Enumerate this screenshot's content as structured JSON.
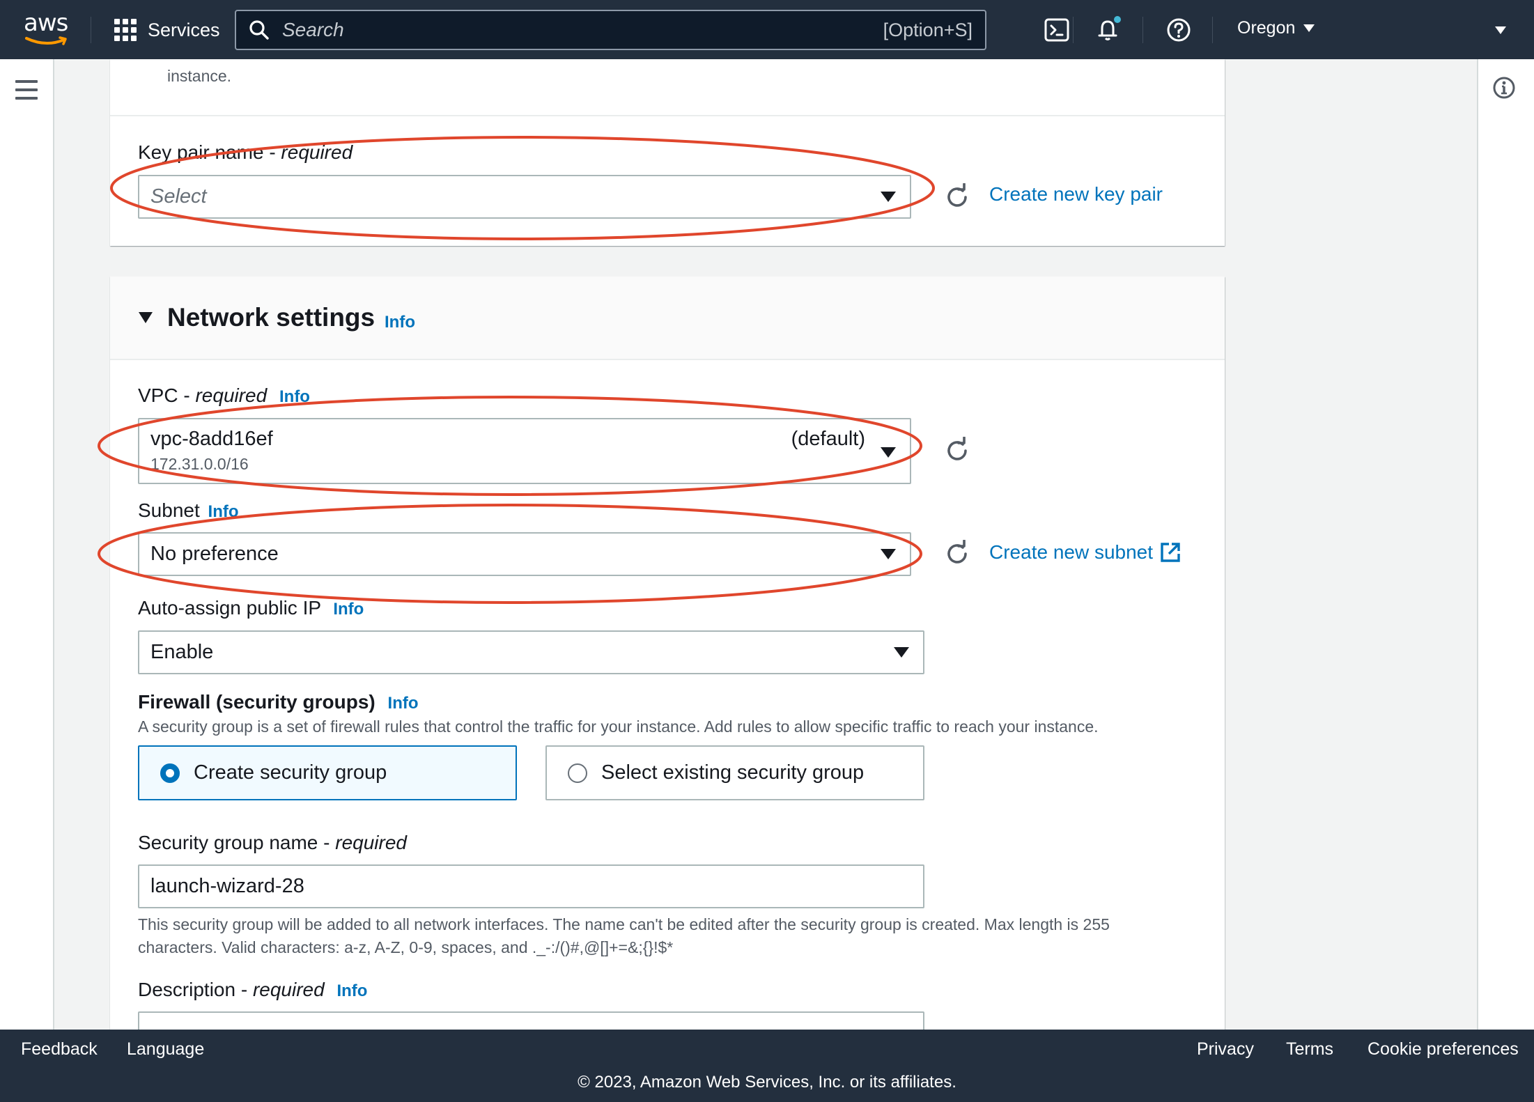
{
  "topnav": {
    "logo_text": "aws",
    "services_label": "Services",
    "search_placeholder": "Search",
    "search_shortcut": "[Option+S]",
    "region_label": "Oregon",
    "notification_dot_color": "#44b9d6"
  },
  "key_pair_panel": {
    "top_desc_fragment": "instance.",
    "key_pair_label": "Key pair name - ",
    "key_pair_required": "required",
    "key_pair_placeholder": "Select",
    "create_key_pair_link": "Create new key pair"
  },
  "network_settings": {
    "title": "Network settings",
    "title_info": "Info",
    "vpc_label": "VPC - ",
    "vpc_required": "required",
    "vpc_info": "Info",
    "vpc_value": "vpc-8add16ef",
    "vpc_default_tag": "(default)",
    "vpc_cidr": "172.31.0.0/16",
    "subnet_label": "Subnet",
    "subnet_info": "Info",
    "subnet_value": "No preference",
    "create_subnet_link": "Create new subnet",
    "auto_ip_label": "Auto-assign public IP",
    "auto_ip_info": "Info",
    "auto_ip_value": "Enable",
    "firewall_label": "Firewall (security groups)",
    "firewall_info": "Info",
    "firewall_desc": "A security group is a set of firewall rules that control the traffic for your instance. Add rules to allow specific traffic to reach your instance.",
    "option_create": "Create security group",
    "option_existing": "Select existing security group",
    "sg_name_label": "Security group name - ",
    "sg_name_required": "required",
    "sg_name_value": "launch-wizard-28",
    "sg_name_hint_line1": "This security group will be added to all network interfaces. The name can't be edited after the security group is created. Max length is 255",
    "sg_name_hint_line2": "characters. Valid characters: a-z, A-Z, 0-9, spaces, and ._-:/()#,@[]+=&;{}!$*",
    "description_label": "Description - ",
    "description_required": "required",
    "description_info": "Info"
  },
  "annotation_color": "#e0462c",
  "footer": {
    "feedback": "Feedback",
    "language": "Language",
    "privacy": "Privacy",
    "terms": "Terms",
    "cookie": "Cookie preferences",
    "copyright": "© 2023, Amazon Web Services, Inc. or its affiliates."
  }
}
